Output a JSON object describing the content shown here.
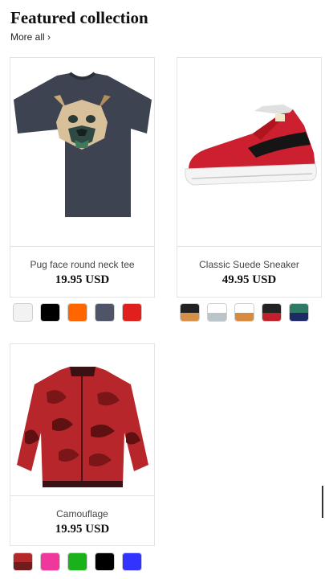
{
  "section": {
    "title": "Featured collection",
    "more_link": "More all ›"
  },
  "products": [
    {
      "name": "Pug face round neck tee",
      "price": "19.95 USD",
      "image_icon": "tshirt-pug-image",
      "swatches": [
        {
          "top": "#f2f2f2",
          "bottom": "#f2f2f2"
        },
        {
          "top": "#000000",
          "bottom": "#000000"
        },
        {
          "top": "#ff6600",
          "bottom": "#ff6600"
        },
        {
          "top": "#4f5468",
          "bottom": "#4f5468"
        },
        {
          "top": "#e0201c",
          "bottom": "#e0201c"
        }
      ]
    },
    {
      "name": "Classic Suede Sneaker",
      "price": "49.95 USD",
      "image_icon": "sneaker-image",
      "swatches": [
        {
          "top": "#222222",
          "bottom": "#d69047"
        },
        {
          "top": "#ffffff",
          "bottom": "#b9c5c9"
        },
        {
          "top": "#ffffff",
          "bottom": "#d68b3f"
        },
        {
          "top": "#222222",
          "bottom": "#c0202c"
        },
        {
          "top": "#2e7a64",
          "bottom": "#1d2a66"
        }
      ]
    },
    {
      "name": "Camouflage",
      "price": "19.95 USD",
      "image_icon": "camo-jacket-image",
      "swatches": [
        {
          "top": "#b5282a",
          "bottom": "#6e1c1c"
        },
        {
          "top": "#f0389c",
          "bottom": "#f0389c"
        },
        {
          "top": "#1bb11b",
          "bottom": "#1bb11b"
        },
        {
          "top": "#000000",
          "bottom": "#000000"
        },
        {
          "top": "#3333ff",
          "bottom": "#3333ff"
        }
      ]
    }
  ]
}
